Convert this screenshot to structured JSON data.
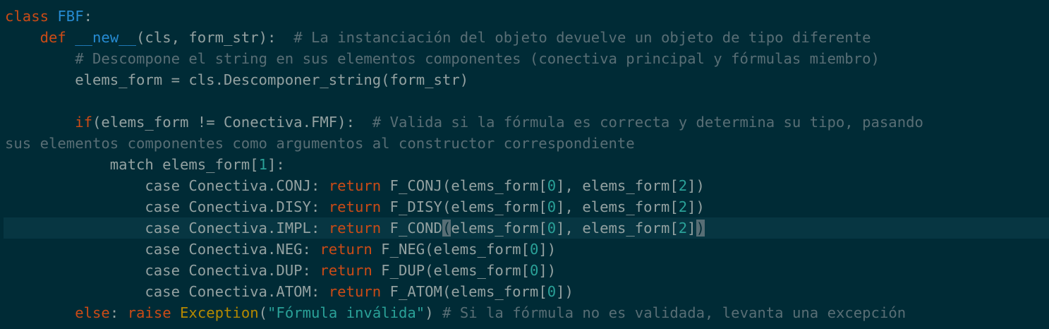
{
  "editor": {
    "colors": {
      "background": "#002b36",
      "current_line": "#073642",
      "text": "#93a1a1",
      "keyword": "#cb4b16",
      "class_name": "#268bd2",
      "number": "#2aa198",
      "string": "#2aa198",
      "builtin": "#b58900",
      "comment": "#586e75"
    },
    "lines": [
      [
        {
          "t": "kw",
          "v": "class"
        },
        {
          "t": "tx",
          "v": " "
        },
        {
          "t": "cl",
          "v": "FBF"
        },
        {
          "t": "tx",
          "v": ":"
        }
      ],
      [
        {
          "t": "tx",
          "v": "    "
        },
        {
          "t": "kw",
          "v": "def"
        },
        {
          "t": "tx",
          "v": " "
        },
        {
          "t": "cl",
          "v": "__new__"
        },
        {
          "t": "tx",
          "v": "(cls, form_str):  "
        },
        {
          "t": "cm",
          "v": "# La instanciación del objeto devuelve un objeto de tipo diferente"
        }
      ],
      [
        {
          "t": "tx",
          "v": "        "
        },
        {
          "t": "cm",
          "v": "# Descompone el string en sus elementos componentes (conectiva principal y fórmulas miembro)"
        }
      ],
      [
        {
          "t": "tx",
          "v": "        elems_form = cls.Descomponer_string(form_str)"
        }
      ],
      [],
      [
        {
          "t": "tx",
          "v": "        "
        },
        {
          "t": "kw",
          "v": "if"
        },
        {
          "t": "tx",
          "v": "(elems_form != Conectiva.FMF):  "
        },
        {
          "t": "cm",
          "v": "# Valida si la fórmula es correcta y determina su tipo, pasando"
        }
      ],
      [
        {
          "t": "cm",
          "v": "sus elementos componentes como argumentos al constructor correspondiente"
        }
      ],
      [
        {
          "t": "tx",
          "v": "            match elems_form["
        },
        {
          "t": "num",
          "v": "1"
        },
        {
          "t": "tx",
          "v": "]:"
        }
      ],
      [
        {
          "t": "tx",
          "v": "                case Conectiva.CONJ: "
        },
        {
          "t": "kw",
          "v": "return"
        },
        {
          "t": "tx",
          "v": " F_CONJ(elems_form["
        },
        {
          "t": "num",
          "v": "0"
        },
        {
          "t": "tx",
          "v": "], elems_form["
        },
        {
          "t": "num",
          "v": "2"
        },
        {
          "t": "tx",
          "v": "])"
        }
      ],
      [
        {
          "t": "tx",
          "v": "                case Conectiva.DISY: "
        },
        {
          "t": "kw",
          "v": "return"
        },
        {
          "t": "tx",
          "v": " F_DISY(elems_form["
        },
        {
          "t": "num",
          "v": "0"
        },
        {
          "t": "tx",
          "v": "], elems_form["
        },
        {
          "t": "num",
          "v": "2"
        },
        {
          "t": "tx",
          "v": "])"
        }
      ],
      [
        {
          "t": "tx",
          "v": "                case Conectiva.IMPL: "
        },
        {
          "t": "kw",
          "v": "return"
        },
        {
          "t": "tx",
          "v": " F_COND"
        },
        {
          "t": "br",
          "v": "("
        },
        {
          "t": "tx",
          "v": "elems_form["
        },
        {
          "t": "num",
          "v": "0"
        },
        {
          "t": "tx",
          "v": "], elems_form["
        },
        {
          "t": "num",
          "v": "2"
        },
        {
          "t": "tx",
          "v": "]"
        },
        {
          "t": "br",
          "v": ")"
        }
      ],
      [
        {
          "t": "tx",
          "v": "                case Conectiva.NEG: "
        },
        {
          "t": "kw",
          "v": "return"
        },
        {
          "t": "tx",
          "v": " F_NEG(elems_form["
        },
        {
          "t": "num",
          "v": "0"
        },
        {
          "t": "tx",
          "v": "])"
        }
      ],
      [
        {
          "t": "tx",
          "v": "                case Conectiva.DUP: "
        },
        {
          "t": "kw",
          "v": "return"
        },
        {
          "t": "tx",
          "v": " F_DUP(elems_form["
        },
        {
          "t": "num",
          "v": "0"
        },
        {
          "t": "tx",
          "v": "])"
        }
      ],
      [
        {
          "t": "tx",
          "v": "                case Conectiva.ATOM: "
        },
        {
          "t": "kw",
          "v": "return"
        },
        {
          "t": "tx",
          "v": " F_ATOM(elems_form["
        },
        {
          "t": "num",
          "v": "0"
        },
        {
          "t": "tx",
          "v": "])"
        }
      ],
      [
        {
          "t": "tx",
          "v": "        "
        },
        {
          "t": "kw",
          "v": "else"
        },
        {
          "t": "tx",
          "v": ": "
        },
        {
          "t": "kw",
          "v": "raise"
        },
        {
          "t": "tx",
          "v": " "
        },
        {
          "t": "exc",
          "v": "Exception"
        },
        {
          "t": "tx",
          "v": "("
        },
        {
          "t": "str",
          "v": "\"Fórmula inválida\""
        },
        {
          "t": "tx",
          "v": ") "
        },
        {
          "t": "cm",
          "v": "# Si la fórmula no es validada, levanta una excepción"
        }
      ]
    ],
    "current_line_index": 10
  }
}
